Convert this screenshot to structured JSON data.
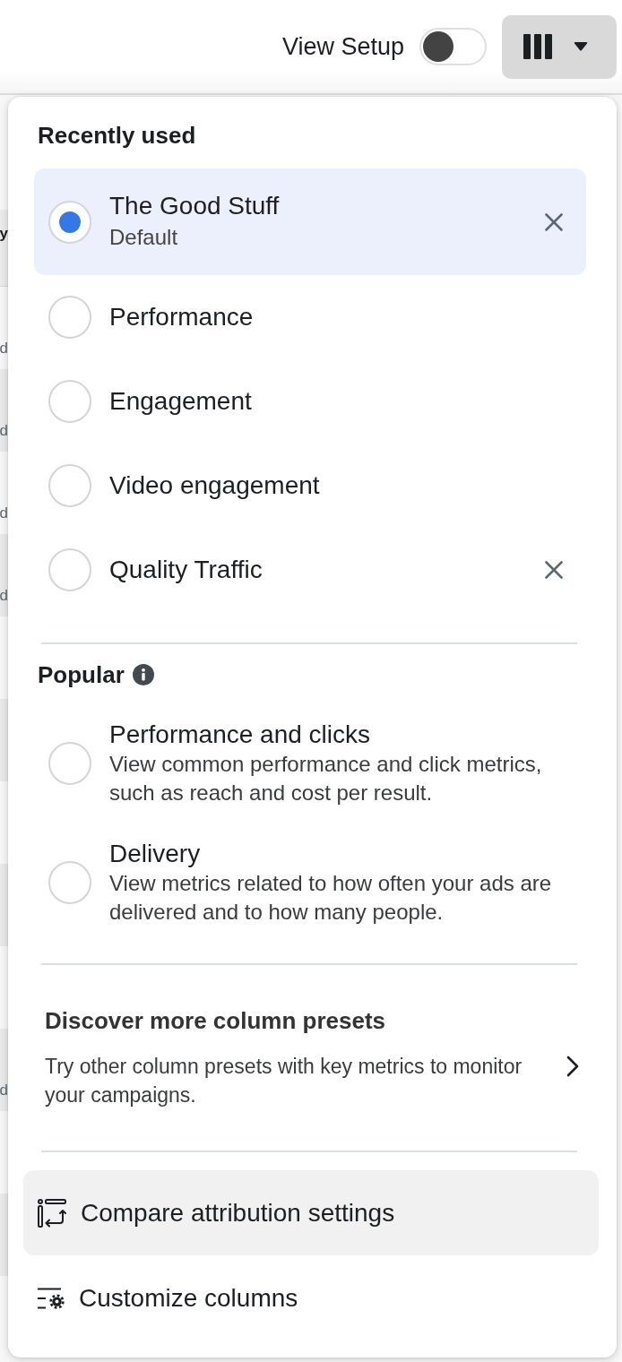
{
  "toolbar": {
    "view_setup": {
      "label": "View Setup",
      "on": false
    },
    "columns_button": {
      "expanded": true
    }
  },
  "table_behind": {
    "header": "y",
    "rows": [
      {
        "cell": "d"
      },
      {
        "cell": "d"
      },
      {
        "cell": "d"
      },
      {
        "cell": "d"
      },
      {},
      {},
      {},
      {},
      {},
      {
        "cell": "d"
      },
      {},
      {},
      {}
    ]
  },
  "column_presets_menu": {
    "recently_used": {
      "title": "Recently used",
      "items": [
        {
          "name": "The Good Stuff",
          "subtitle": "Default",
          "selected": true,
          "removable": true
        },
        {
          "name": "Performance",
          "selected": false,
          "removable": false
        },
        {
          "name": "Engagement",
          "selected": false,
          "removable": false
        },
        {
          "name": "Video engagement",
          "selected": false,
          "removable": false
        },
        {
          "name": "Quality Traffic",
          "selected": false,
          "removable": true
        }
      ]
    },
    "popular": {
      "title": "Popular",
      "items": [
        {
          "name": "Performance and clicks",
          "description": "View common performance and click metrics, such as reach and cost per result.",
          "selected": false
        },
        {
          "name": "Delivery",
          "description": "View metrics related to how often your ads are delivered and to how many people.",
          "selected": false
        }
      ]
    },
    "discover": {
      "title": "Discover more column presets",
      "description": "Try other column presets with key metrics to monitor your campaigns."
    },
    "actions": [
      {
        "kind": "compare",
        "label": "Compare attribution settings",
        "hovered": true
      },
      {
        "kind": "customize",
        "label": "Customize columns",
        "hovered": false
      }
    ]
  }
}
